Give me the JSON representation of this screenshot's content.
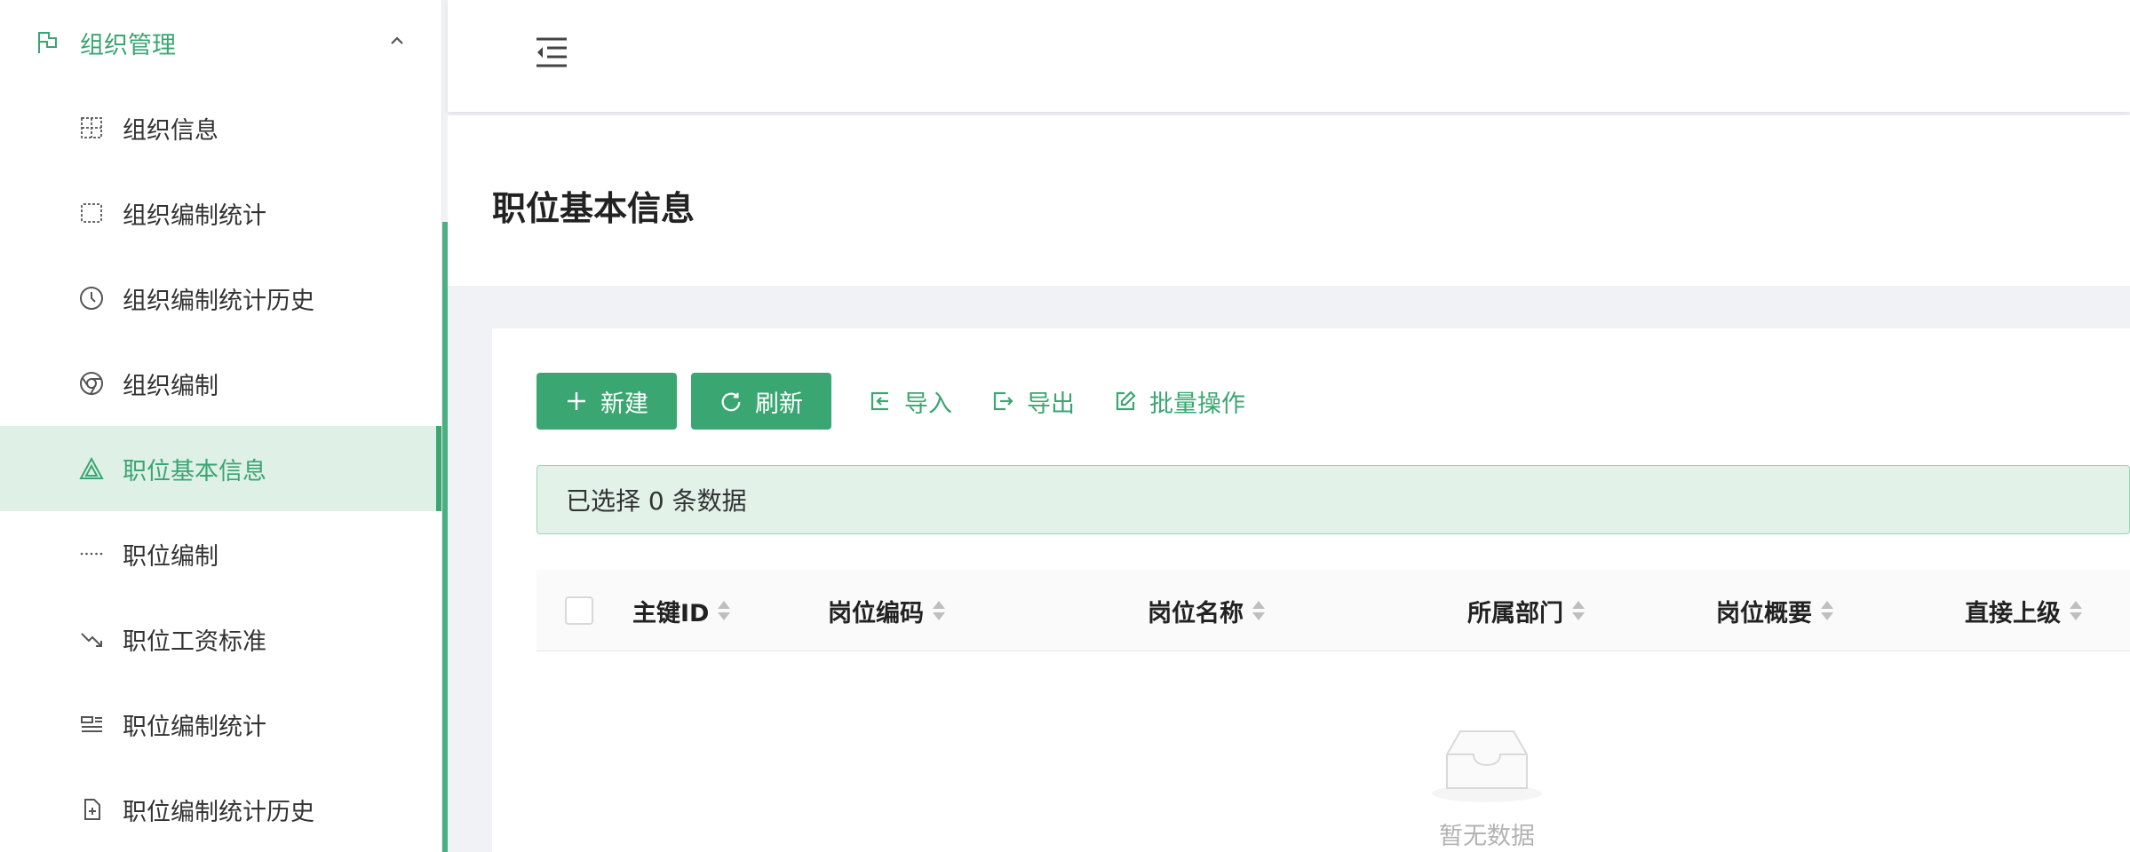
{
  "sidebar": {
    "group": {
      "label": "组织管理",
      "icon": "flag-icon",
      "expanded": true
    },
    "items": [
      {
        "label": "组织信息",
        "icon": "grid-icon",
        "active": false
      },
      {
        "label": "组织编制统计",
        "icon": "dashed-box-icon",
        "active": false
      },
      {
        "label": "组织编制统计历史",
        "icon": "clock-icon",
        "active": false
      },
      {
        "label": "组织编制",
        "icon": "chrome-icon",
        "active": false
      },
      {
        "label": "职位基本信息",
        "icon": "triangle-icon",
        "active": true
      },
      {
        "label": "职位编制",
        "icon": "dots-icon",
        "active": false
      },
      {
        "label": "职位工资标准",
        "icon": "trend-down-icon",
        "active": false
      },
      {
        "label": "职位编制统计",
        "icon": "layout-icon",
        "active": false
      },
      {
        "label": "职位编制统计历史",
        "icon": "file-plus-icon",
        "active": false
      }
    ]
  },
  "header": {
    "collapse_icon": "menu-fold-icon"
  },
  "page": {
    "title": "职位基本信息"
  },
  "toolbar": {
    "new_label": "新建",
    "refresh_label": "刷新",
    "import_label": "导入",
    "export_label": "导出",
    "batch_label": "批量操作"
  },
  "selection": {
    "text": "已选择 0 条数据"
  },
  "table": {
    "columns": [
      "主键ID",
      "岗位编码",
      "岗位名称",
      "所属部门",
      "岗位概要",
      "直接上级"
    ]
  },
  "empty": {
    "text": "暂无数据"
  },
  "colors": {
    "accent": "#3aa672",
    "active_bg": "#dff0e6"
  }
}
